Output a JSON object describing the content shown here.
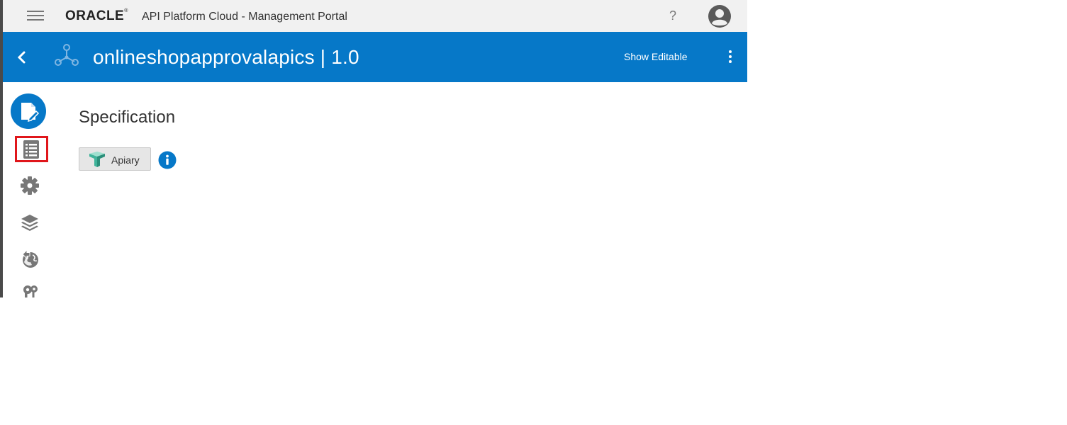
{
  "topbar": {
    "menu_icon": "hamburger-icon",
    "brand": "ORACLE",
    "brand_mark": "®",
    "portal_title": "API Platform Cloud - Management Portal",
    "help_label": "?",
    "avatar_icon": "user-avatar-icon"
  },
  "header": {
    "back_icon": "chevron-left-icon",
    "api_icon": "api-nodes-icon",
    "api_name": "onlineshopapprovalapics | 1.0",
    "show_editable_label": "Show Editable",
    "more_icon": "kebab-menu-icon",
    "background": "#0678c8"
  },
  "sidebar": {
    "items": [
      {
        "name": "api-specification",
        "icon": "document-edit-icon",
        "active": true
      },
      {
        "name": "api-documentation",
        "icon": "list-document-icon",
        "highlighted": true
      },
      {
        "name": "api-policies",
        "icon": "gear-icon"
      },
      {
        "name": "api-deployments",
        "icon": "layers-icon"
      },
      {
        "name": "api-publication",
        "icon": "globe-arrow-icon"
      },
      {
        "name": "api-grants",
        "icon": "key-icon"
      }
    ]
  },
  "main": {
    "section_title": "Specification",
    "apiary_button_label": "Apiary",
    "apiary_icon": "apiary-logo-icon",
    "info_icon": "info-icon"
  },
  "colors": {
    "accent": "#0678c8",
    "highlight_box": "#e0161b",
    "topbar_bg": "#f1f1f1"
  }
}
